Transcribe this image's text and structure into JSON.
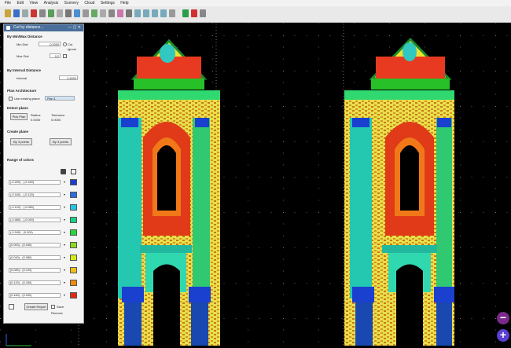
{
  "menu": [
    "File",
    "Edit",
    "View",
    "Analysis",
    "Scenery",
    "Cloud",
    "Settings",
    "Help"
  ],
  "panel": {
    "title": "Cut by distance...",
    "title_controls": "— ▢ ✕",
    "sec_minmax": "By Min/Max Distance",
    "min_dist_label": "Min Dist",
    "min_dist_value": "-0.2000",
    "max_dist_label": "Max Dist",
    "max_dist_value": "0.2",
    "opt_cut": "Cut",
    "opt_ignore": "Ignore",
    "sec_interval": "By Interval Distance",
    "interval_label": "Interval",
    "interval_value": "0.4000",
    "sec_planarity": "Plan Architecture",
    "use_existing_plane": "Use existing plane",
    "plane_option": "Plan 1",
    "sec_detect": "Detect plane",
    "pick_plan_btn": "Pick Plan",
    "radius_label": "Radius",
    "radius_value": "0.0000",
    "tolerance_label": "Tolerance",
    "tolerance_value": "0.0000",
    "sec_create": "Create plane",
    "by_3_points": "By 3 points",
    "by_3_points_2": "By 3 points",
    "sec_range": "Range of colors",
    "ranges": [
      {
        "label": "(-0.200) - (-0.160)",
        "color": "#1c3fd0"
      },
      {
        "label": "(-0.160) - (-0.120)",
        "color": "#2a6ee0"
      },
      {
        "label": "(-0.120) - (-0.080)",
        "color": "#22c6e6"
      },
      {
        "label": "(-0.080) - (-0.040)",
        "color": "#1ad088"
      },
      {
        "label": "(-0.040) - (0.000)",
        "color": "#27d838"
      },
      {
        "label": "(0.000) - (0.040)",
        "color": "#8cda1e"
      },
      {
        "label": "(0.040) - (0.080)",
        "color": "#d8e81a"
      },
      {
        "label": "(0.080) - (0.120)",
        "color": "#f0c018"
      },
      {
        "label": "(0.120) - (0.160)",
        "color": "#f08a14"
      },
      {
        "label": "(0.160) - (0.200)",
        "color": "#e22a12"
      }
    ],
    "create_report_btn": "Create Report",
    "save_label": "Save",
    "remove_label": "Remove"
  },
  "colors": {
    "window_title_bar": "#4a6f9a",
    "zoom_out": "#7b2a8c",
    "zoom_in": "#5a3fd0"
  },
  "zoom_out_glyph": "−",
  "zoom_in_glyph": "+"
}
